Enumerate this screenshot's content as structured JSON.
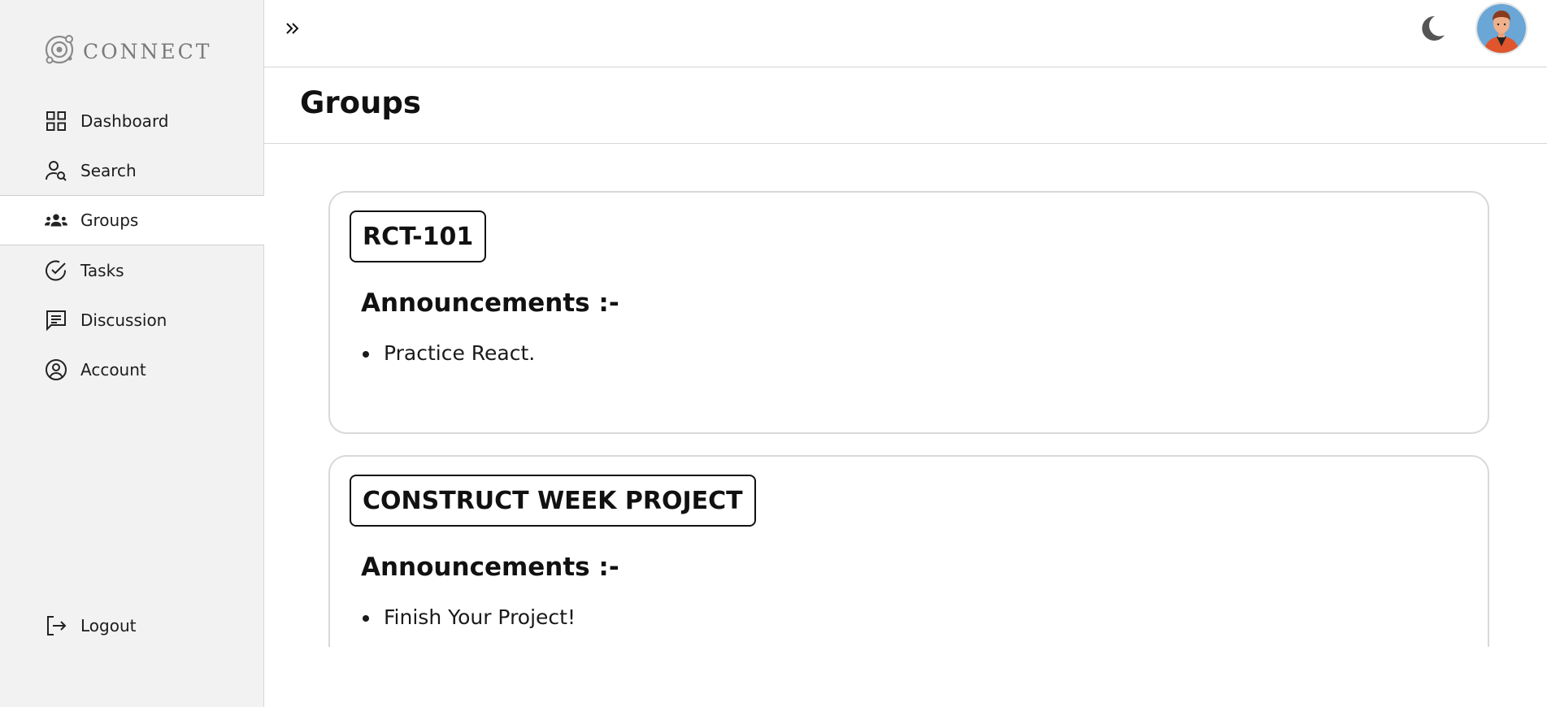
{
  "app": {
    "brand": "CONNECT"
  },
  "sidebar": {
    "items": [
      {
        "label": "Dashboard",
        "icon": "grid-icon",
        "active": false
      },
      {
        "label": "Search",
        "icon": "user-search-icon",
        "active": false
      },
      {
        "label": "Groups",
        "icon": "users-group-icon",
        "active": true
      },
      {
        "label": "Tasks",
        "icon": "check-circle-icon",
        "active": false
      },
      {
        "label": "Discussion",
        "icon": "message-square-icon",
        "active": false
      },
      {
        "label": "Account",
        "icon": "user-circle-icon",
        "active": false
      }
    ],
    "logout_label": "Logout"
  },
  "topbar": {
    "expand_icon": "chevrons-right-icon",
    "theme_icon": "moon-icon",
    "avatar": "avatar"
  },
  "page": {
    "title": "Groups"
  },
  "groups": [
    {
      "name": "RCT-101",
      "announcements_title": "Announcements :-",
      "announcements": [
        "Practice React."
      ]
    },
    {
      "name": "CONSTRUCT WEEK PROJECT",
      "announcements_title": "Announcements :-",
      "announcements": [
        "Finish Your Project!"
      ]
    }
  ],
  "colors": {
    "sidebar_bg": "#f2f2f2",
    "border": "#d6d6d6",
    "text": "#111111",
    "moon": "#555555",
    "avatar_bg": "#6aa6d6",
    "avatar_shirt": "#e0552c"
  }
}
